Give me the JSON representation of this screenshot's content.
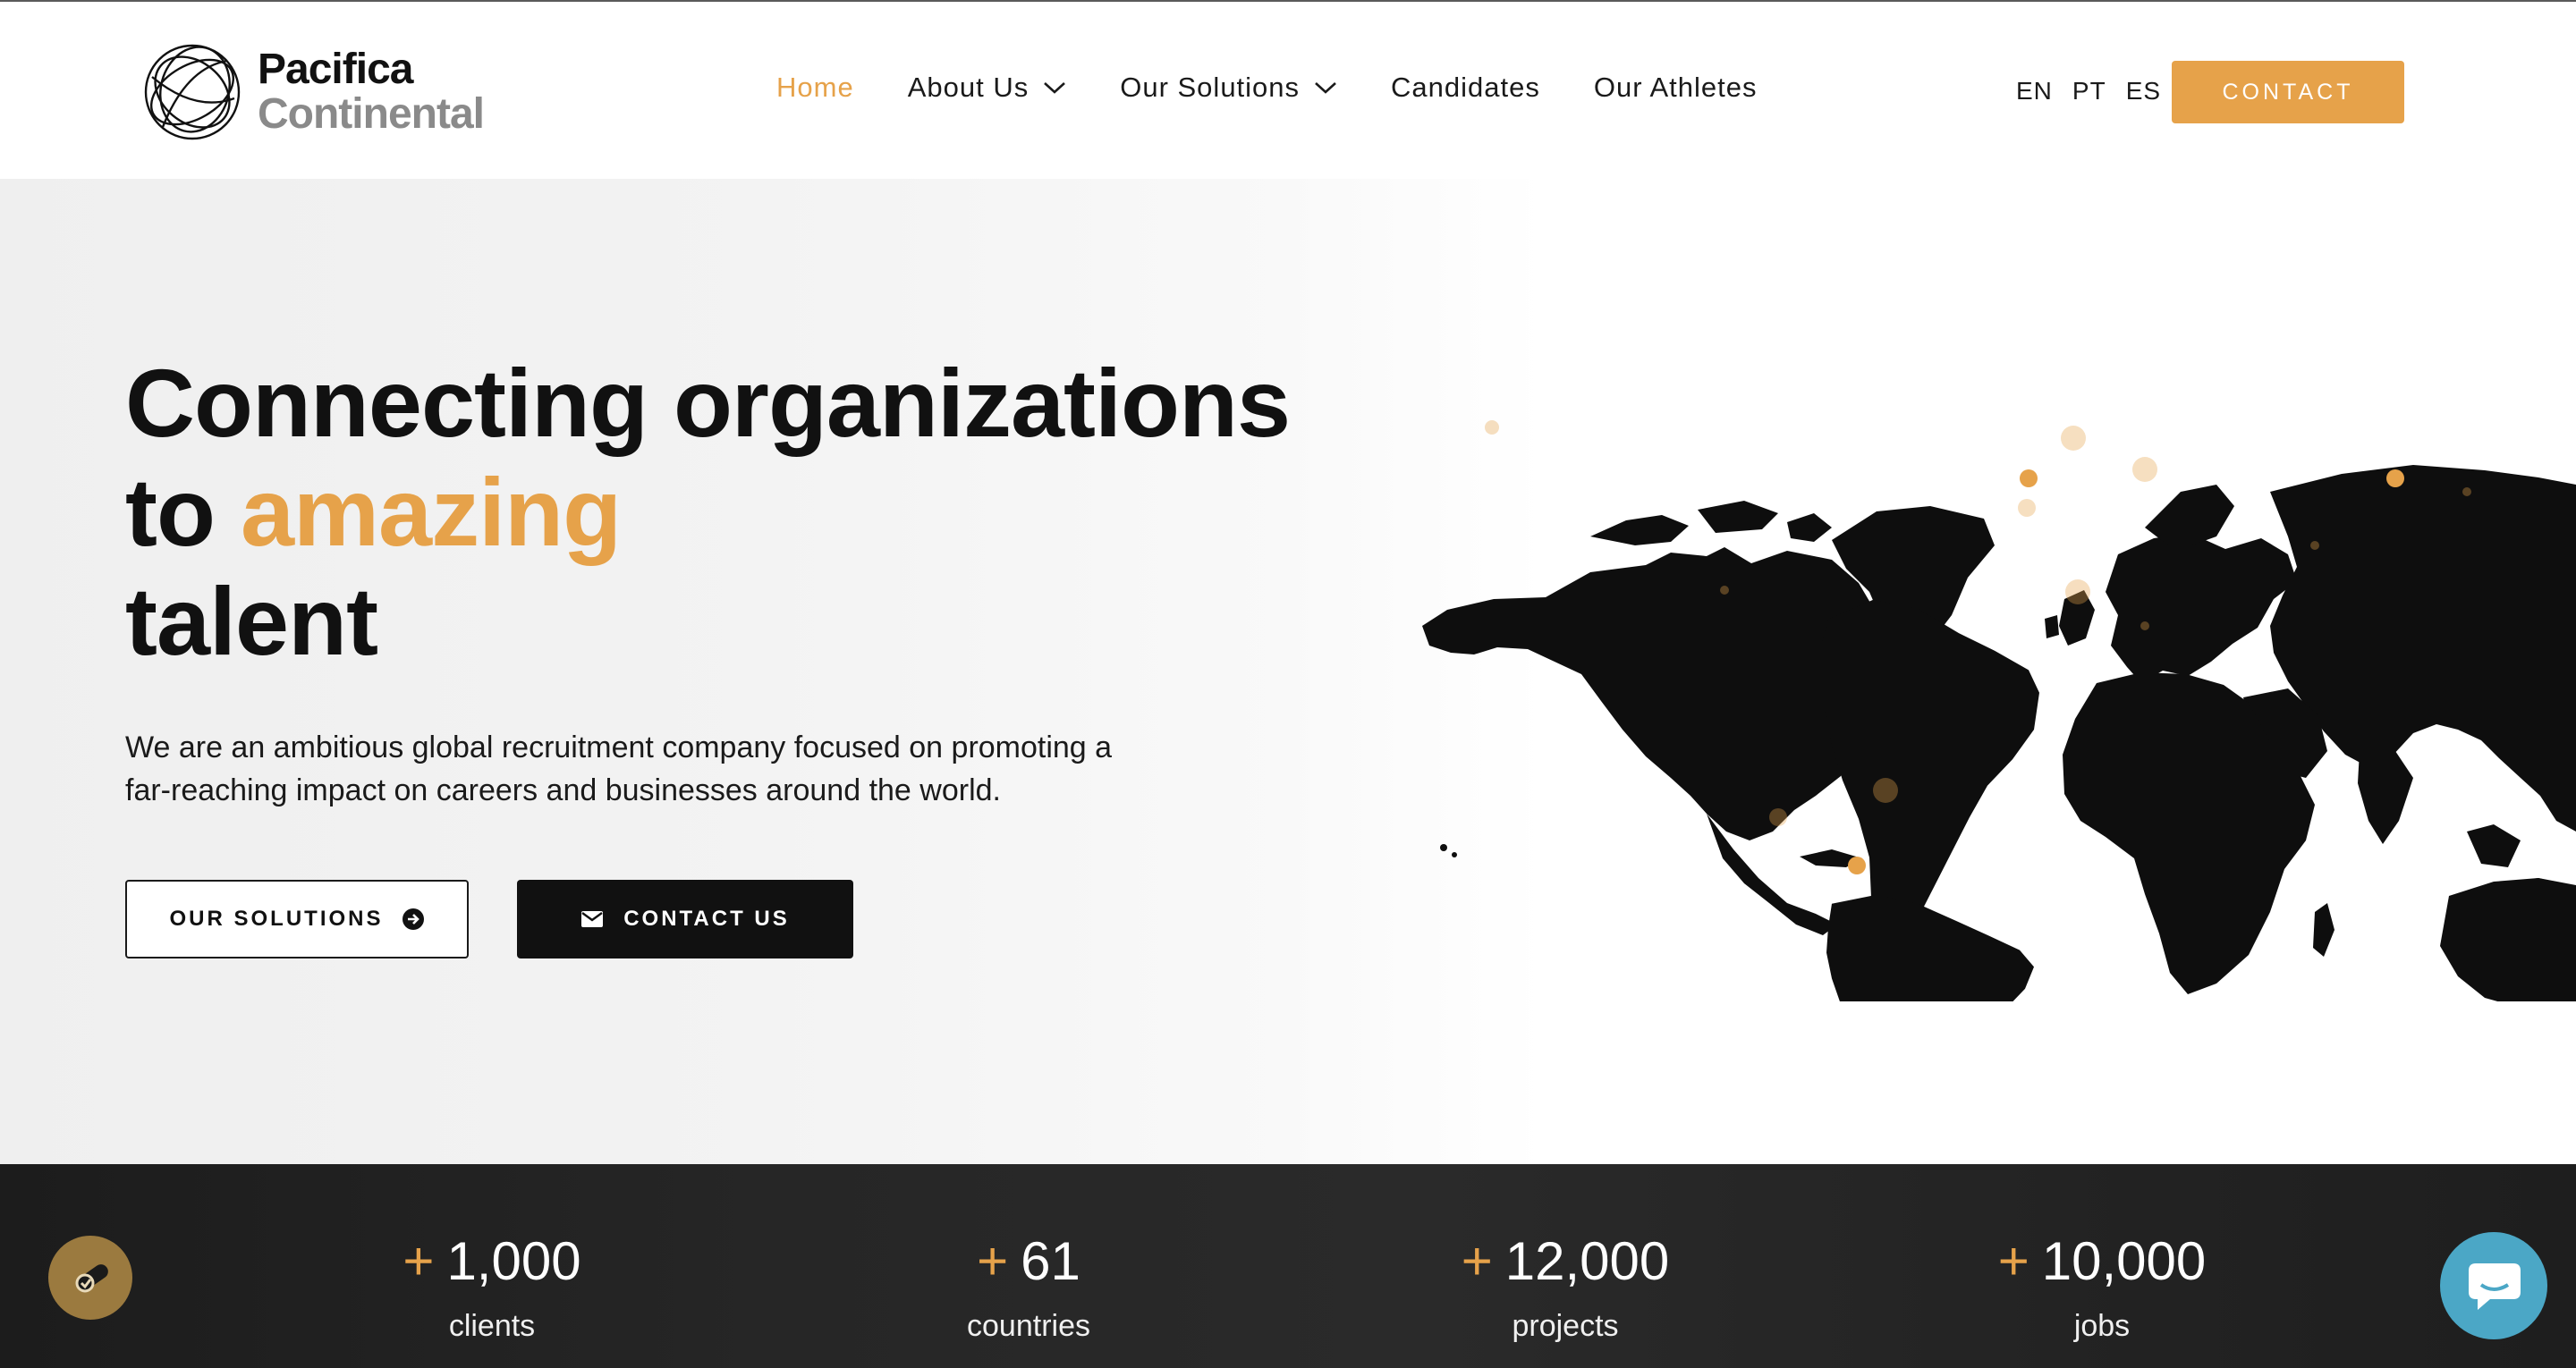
{
  "brand": {
    "line1": "Pacifica",
    "line2": "Continental",
    "accent": "#e6a24a"
  },
  "nav": {
    "items": [
      {
        "label": "Home",
        "active": true,
        "has_dropdown": false
      },
      {
        "label": "About Us",
        "active": false,
        "has_dropdown": true
      },
      {
        "label": "Our Solutions",
        "active": false,
        "has_dropdown": true
      },
      {
        "label": "Candidates",
        "active": false,
        "has_dropdown": false
      },
      {
        "label": "Our Athletes",
        "active": false,
        "has_dropdown": false
      }
    ],
    "languages": [
      "EN",
      "PT",
      "ES"
    ],
    "contact_label": "CONTACT"
  },
  "hero": {
    "title_line1": "Connecting organizations",
    "title_to": "to",
    "title_accent": "amazing",
    "title_line3": "talent",
    "subtitle_line1": "We are an ambitious global recruitment company focused on promoting a",
    "subtitle_line2": "far-reaching impact on careers and businesses around the world.",
    "btn_solutions": "OUR SOLUTIONS",
    "btn_contact": "CONTACT US"
  },
  "stats": [
    {
      "prefix": "+",
      "value": "1,000",
      "label": "clients"
    },
    {
      "prefix": "+",
      "value": "61",
      "label": "countries"
    },
    {
      "prefix": "+",
      "value": "12,000",
      "label": "projects"
    },
    {
      "prefix": "+",
      "value": "10,000",
      "label": "jobs"
    }
  ],
  "icons": {
    "logo": "circle-lines-logo-icon",
    "dropdown": "chevron-down-icon",
    "solutions": "arrow-circle-right-icon",
    "contact": "envelope-icon",
    "accessibility": "accessibility-icon",
    "chat": "chat-bubble-icon"
  }
}
